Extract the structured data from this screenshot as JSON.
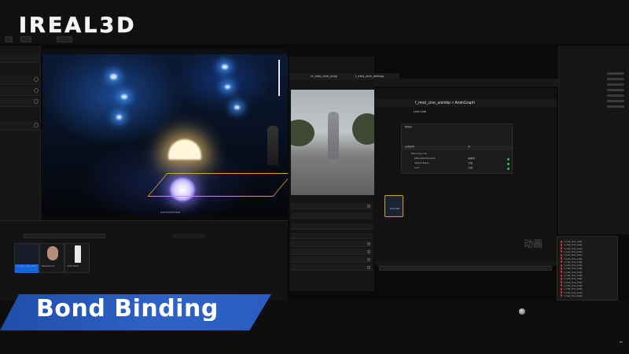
{
  "overlay": {
    "logo": "IREAL3D",
    "banner": "Bond Binding"
  },
  "anim_editor": {
    "tabs": [
      "rx_med_cine_body",
      "f_med_cine_animbp"
    ],
    "graph_tab": "AnimGraph",
    "breadcrumb": "f_med_cine_animbp > AnimGraph",
    "node_label": "Live Link",
    "table_headers": [
      "属性名",
      "值"
    ],
    "section": "主题名称",
    "tree_items": [
      "Mobu Live Link",
      "EditorActiveCamera",
      "Subject Bones",
      "Look"
    ],
    "tree_states": [
      "需要的",
      "已跟",
      "已跟"
    ],
    "watermark": "动画"
  },
  "log": {
    "lines": [
      "f_med_cine_body",
      "f_med_cine_body",
      "f_med_cine_body",
      "f_med_cine_body",
      "f_med_cine_body",
      "f_med_cine_body",
      "f_med_cine_body",
      "f_med_cine_body",
      "f_med_cine_body",
      "f_med_cine_body",
      "f_med_cine_body",
      "f_med_cine_body",
      "f_med_cine_body",
      "f_med_cine_body",
      "f_med_cine_body",
      "f_med_cine_body",
      "f_med_cine_body"
    ]
  },
  "content_browser": {
    "assets": [
      {
        "label": "m_med_cine_body"
      },
      {
        "label": "MetaHuman"
      },
      {
        "label": "Cloth Mesh"
      }
    ]
  },
  "colors": {
    "accent": "#1664e0",
    "banner": "#2e62c7",
    "node_border": "#d9a400",
    "log_error": "#c0303a"
  }
}
